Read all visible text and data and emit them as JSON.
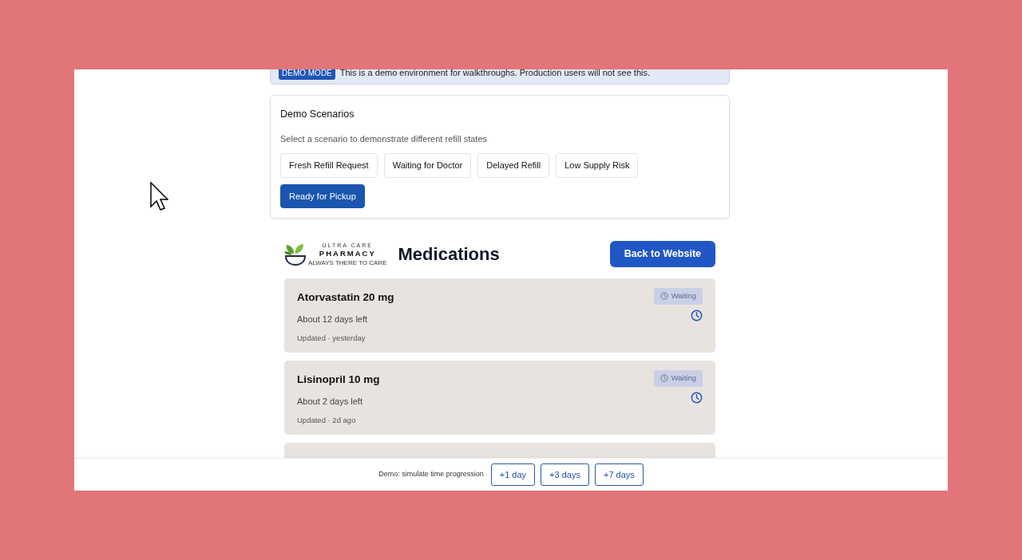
{
  "demo_banner": {
    "badge": "DEMO MODE",
    "text": "This is a demo environment for walkthroughs. Production users will not see this."
  },
  "scenarios": {
    "title": "Demo Scenarios",
    "subtitle": "Select a scenario to demonstrate different refill states",
    "items": [
      {
        "label": "Fresh Refill Request",
        "selected": false
      },
      {
        "label": "Waiting for Doctor",
        "selected": false
      },
      {
        "label": "Delayed Refill",
        "selected": false
      },
      {
        "label": "Low Supply Risk",
        "selected": false
      },
      {
        "label": "Ready for Pickup",
        "selected": true
      }
    ]
  },
  "header": {
    "logo": {
      "line1": "ULTRA CARE",
      "line2": "PHARMACY",
      "tagline": "ALWAYS THERE TO CARE"
    },
    "title": "Medications",
    "back_button": "Back to Website"
  },
  "medications": [
    {
      "name": "Atorvastatin 20 mg",
      "supply": "About 12 days left",
      "updated": "Updated · yesterday",
      "status": "Waiting"
    },
    {
      "name": "Lisinopril 10 mg",
      "supply": "About 2 days left",
      "updated": "Updated · 2d ago",
      "status": "Waiting"
    }
  ],
  "time_bar": {
    "label": "Demo: simulate time progression",
    "buttons": [
      "+1 day",
      "+3 days",
      "+7 days"
    ]
  }
}
